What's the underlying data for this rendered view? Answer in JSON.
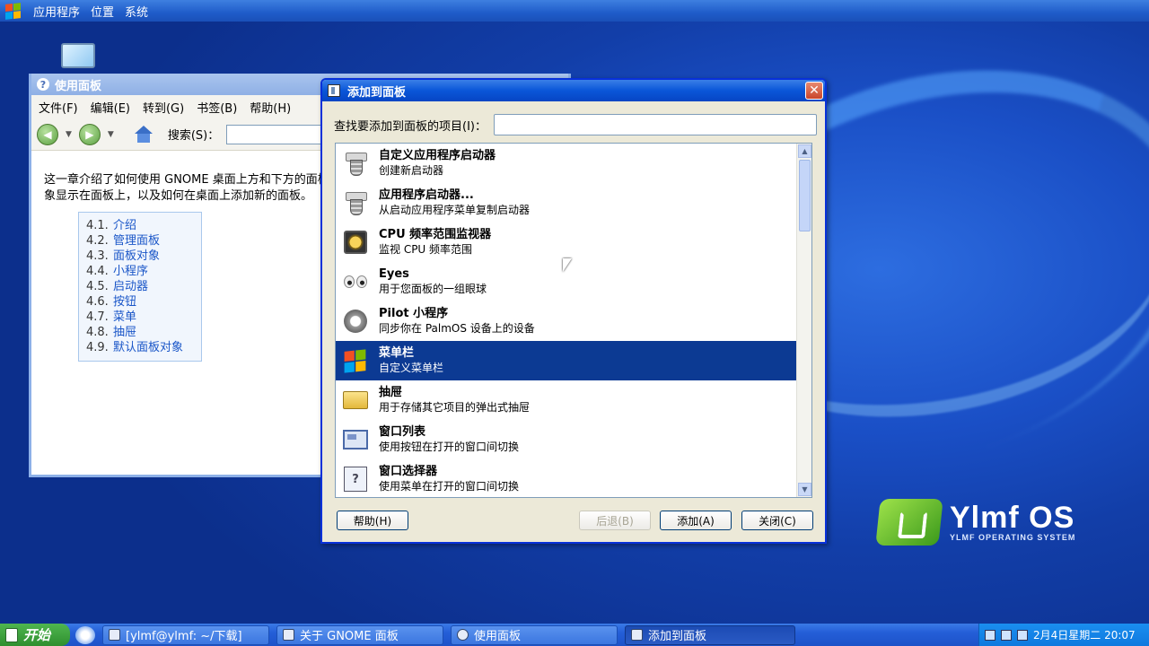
{
  "top_panel": {
    "menus": [
      "应用程序",
      "位置",
      "系统"
    ]
  },
  "help_window": {
    "title": "使用面板",
    "menus": [
      "文件(F)",
      "编辑(E)",
      "转到(G)",
      "书签(B)",
      "帮助(H)"
    ],
    "search_label": "搜索(S)：",
    "intro_line1": "这一章介绍了如何使用 GNOME 桌面上方和下方的面板",
    "intro_line2": "象显示在面板上，以及如何在桌面上添加新的面板。",
    "toc": [
      {
        "num": "4.1.",
        "label": "介绍"
      },
      {
        "num": "4.2.",
        "label": "管理面板"
      },
      {
        "num": "4.3.",
        "label": "面板对象"
      },
      {
        "num": "4.4.",
        "label": "小程序"
      },
      {
        "num": "4.5.",
        "label": "启动器"
      },
      {
        "num": "4.6.",
        "label": "按钮"
      },
      {
        "num": "4.7.",
        "label": "菜单"
      },
      {
        "num": "4.8.",
        "label": "抽屉"
      },
      {
        "num": "4.9.",
        "label": "默认面板对象"
      }
    ]
  },
  "dialog": {
    "title": "添加到面板",
    "find_label": "查找要添加到面板的项目(I)：",
    "find_value": "",
    "items": [
      {
        "title": "自定义应用程序启动器",
        "desc": "创建新启动器",
        "icon": "launcher-icon"
      },
      {
        "title": "应用程序启动器...",
        "desc": "从启动应用程序菜单复制启动器",
        "icon": "launcher-icon"
      },
      {
        "title": "CPU 频率范围监视器",
        "desc": "监视 CPU 频率范围",
        "icon": "cpu-icon"
      },
      {
        "title": "Eyes",
        "desc": "用于您面板的一组眼球",
        "icon": "eyes-icon"
      },
      {
        "title": "Pilot 小程序",
        "desc": "同步你在 PalmOS 设备上的设备",
        "icon": "pilot-icon"
      },
      {
        "title": "菜单栏",
        "desc": "自定义菜单栏",
        "icon": "menubar-icon",
        "selected": true
      },
      {
        "title": "抽屉",
        "desc": "用于存储其它项目的弹出式抽屉",
        "icon": "drawer-icon"
      },
      {
        "title": "窗口列表",
        "desc": "使用按钮在打开的窗口间切换",
        "icon": "window-list-icon"
      },
      {
        "title": "窗口选择器",
        "desc": "使用菜单在打开的窗口间切换",
        "icon": "window-chooser-icon"
      }
    ],
    "buttons": {
      "help": "帮助(H)",
      "back": "后退(B)",
      "add": "添加(A)",
      "close": "关闭(C)"
    }
  },
  "brand": {
    "name": "Ylmf OS",
    "tagline": "YLMF OPERATING SYSTEM"
  },
  "taskbar": {
    "start": "开始",
    "tasks": [
      "[ylmf@ylmf: ~/下载]",
      "关于 GNOME 面板",
      "使用面板",
      "添加到面板"
    ],
    "clock": "2月4日星期二 20:07"
  },
  "colors": {
    "selection": "#0c3a93",
    "title_bar": "#0a56d8",
    "desktop": "#1a4fc6"
  }
}
